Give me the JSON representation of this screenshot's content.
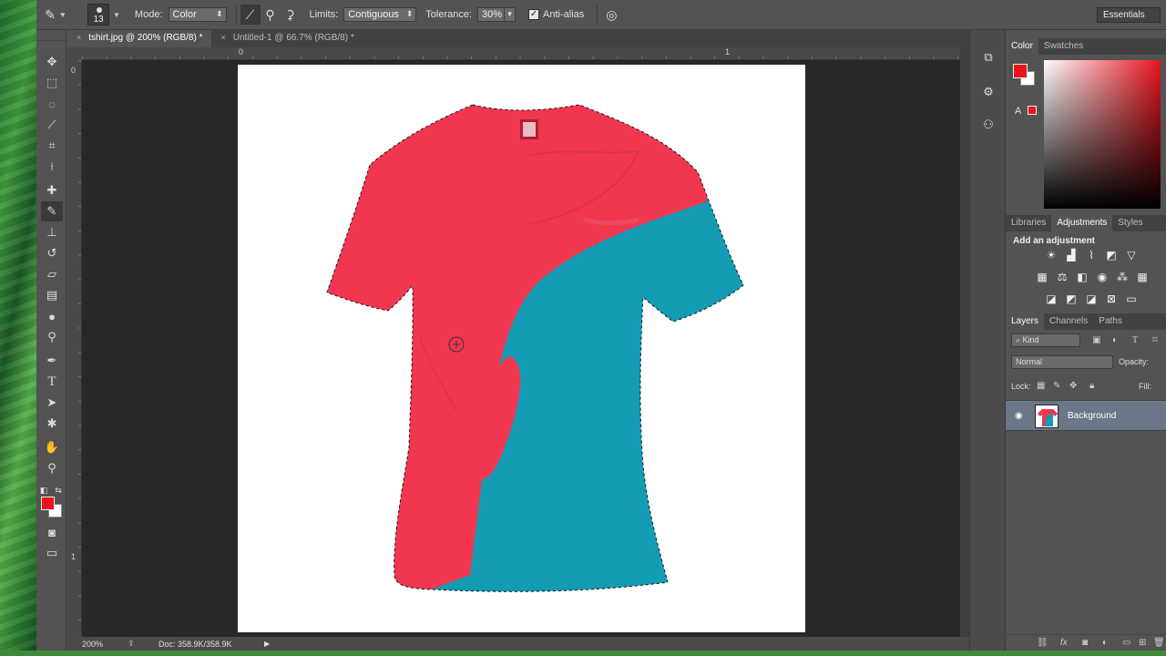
{
  "options_bar": {
    "brush_size": "13",
    "mode_label": "Mode:",
    "mode_value": "Color",
    "limits_label": "Limits:",
    "limits_value": "Contiguous",
    "tolerance_label": "Tolerance:",
    "tolerance_value": "30%",
    "antialias_label": "Anti-alias",
    "antialias_checked": true,
    "workspace": "Essentials"
  },
  "tabs": [
    {
      "label": "tshirt.jpg @ 200% (RGB/8) *",
      "active": true
    },
    {
      "label": "Untitled-1 @ 66.7% (RGB/8) *",
      "active": false
    }
  ],
  "rulers": {
    "h0": "0",
    "h1": "1",
    "v0": "0",
    "v1": "1"
  },
  "status": {
    "zoom": "200%",
    "doc": "Doc: 358.9K/358.9K"
  },
  "colors": {
    "foreground": "#e8141e",
    "background": "#ffffff",
    "shirt_red": "#f0374f",
    "shirt_teal": "#149bb4"
  },
  "color_panel": {
    "tabs": [
      "Color",
      "Swatches"
    ]
  },
  "adjustments_panel": {
    "tabs": [
      "Libraries",
      "Adjustments",
      "Styles"
    ],
    "title": "Add an adjustment"
  },
  "layers_panel": {
    "tabs": [
      "Layers",
      "Channels",
      "Paths"
    ],
    "kind_placeholder": "Kind",
    "blend_mode": "Normal",
    "opacity_label": "Opacity:",
    "lock_label": "Lock:",
    "fill_label": "Fill:",
    "layers": [
      {
        "name": "Background",
        "visible": true
      }
    ]
  }
}
